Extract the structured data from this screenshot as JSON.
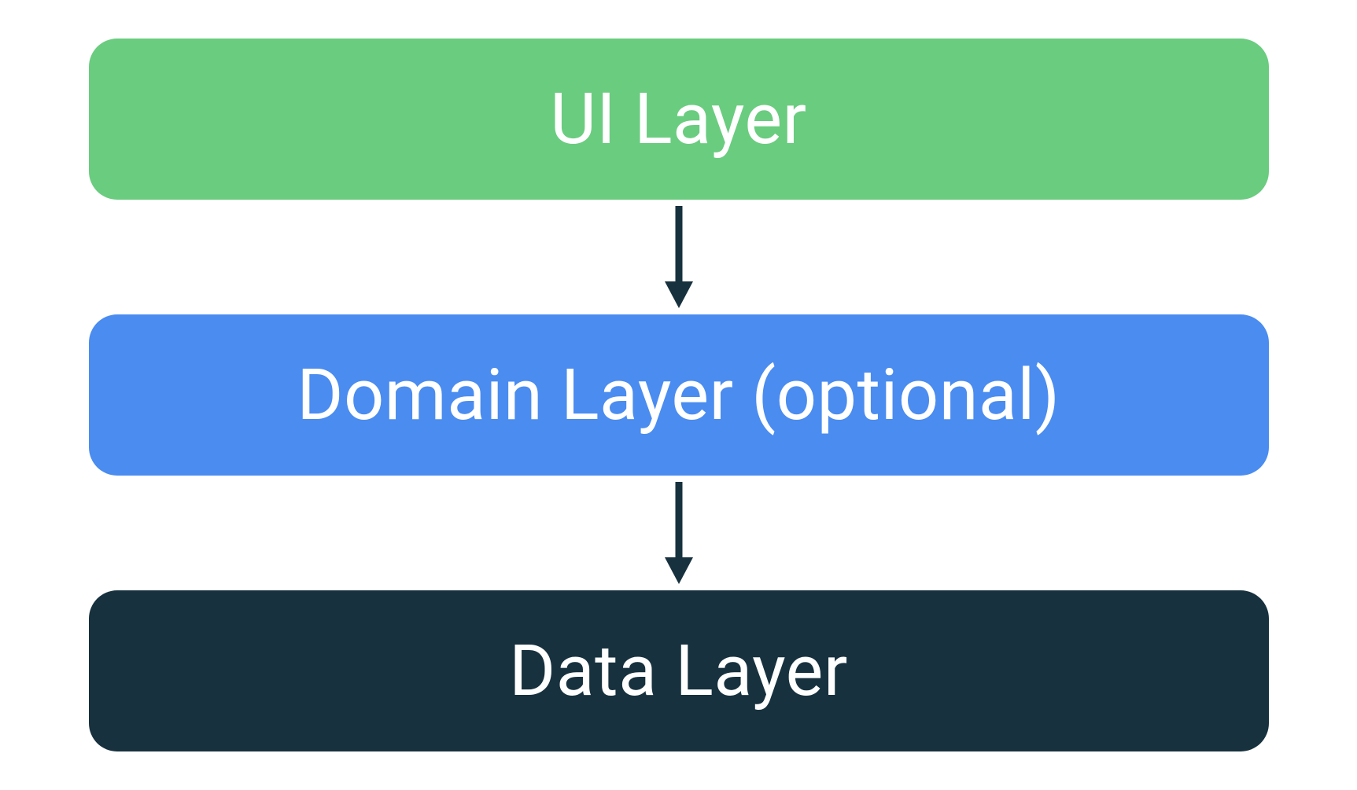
{
  "layers": {
    "ui": {
      "label": "UI Layer",
      "color": "#6ACC7F"
    },
    "domain": {
      "label": "Domain Layer (optional)",
      "color": "#4A8CF0"
    },
    "data": {
      "label": "Data Layer",
      "color": "#17313E"
    }
  },
  "arrow_color": "#17313E"
}
